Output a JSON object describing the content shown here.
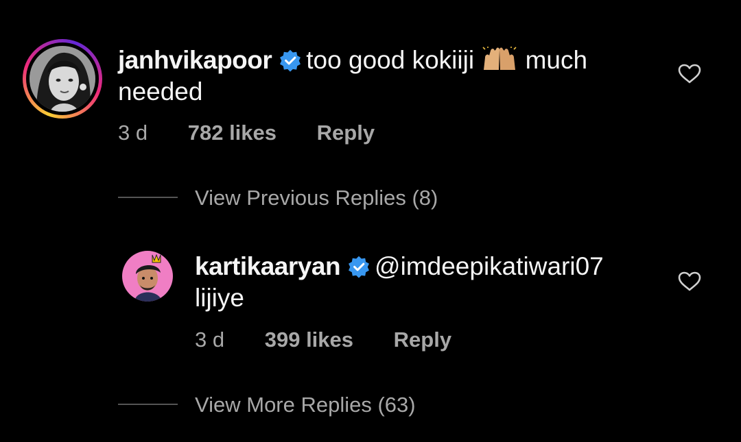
{
  "comments": [
    {
      "username": "janhvikapoor",
      "verified": true,
      "text_before_emoji": "too good kokiiji",
      "emoji": "raising-hands-emoji",
      "text_after_emoji": "much",
      "text_line2": "needed",
      "time": "3 d",
      "likes": "782 likes",
      "reply_label": "Reply"
    },
    {
      "username": "kartikaaryan",
      "verified": true,
      "mention": "@imdeepikatiwari07",
      "text_line2": "lijiye",
      "time": "3 d",
      "likes": "399 likes",
      "reply_label": "Reply"
    }
  ],
  "view_previous_replies": "View Previous Replies (8)",
  "view_more_replies": "View More Replies (63)",
  "colors": {
    "background": "#000000",
    "text": "#f5f5f5",
    "secondary": "#a8a8a8",
    "verified_badge": "#3897f0"
  }
}
